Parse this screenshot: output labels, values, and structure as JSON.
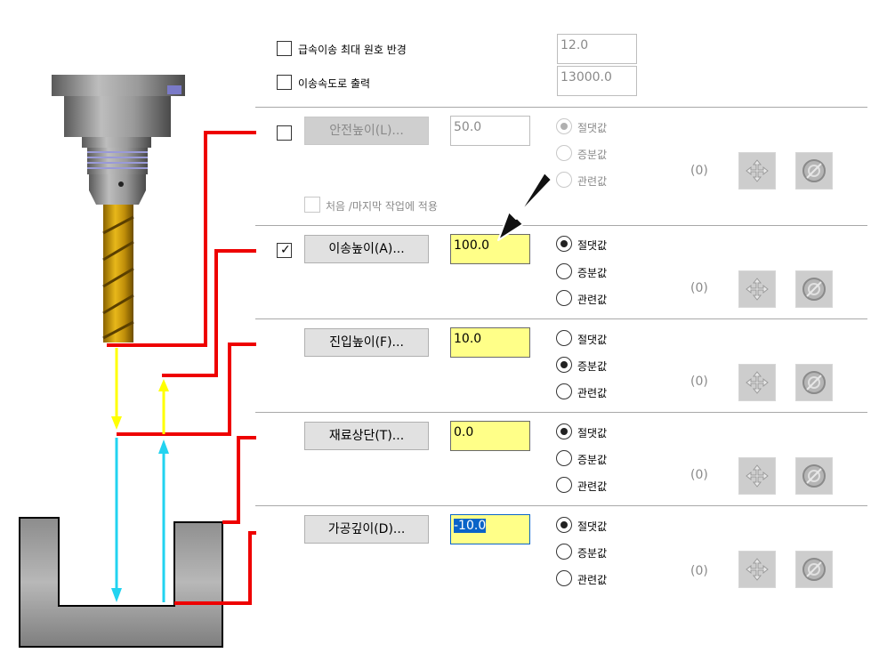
{
  "top": {
    "rapid_arc": {
      "label": "급속이송 최대 원호 반경",
      "value": "12.0"
    },
    "feed_output": {
      "label": "이송속도로 출력",
      "value": "13000.0"
    }
  },
  "options": {
    "absolute": "절댓값",
    "incremental": "증분값",
    "relative": "관련값"
  },
  "apply_first_last": "처음 /마지막 작업에 적용",
  "rows": [
    {
      "button": "안전높이(L)...",
      "value": "50.0",
      "checkbox_checked": false,
      "mode": "absolute",
      "zero": "(0)"
    },
    {
      "button": "이송높이(A)...",
      "value": "100.0",
      "checkbox_checked": true,
      "mode": "absolute",
      "zero": "(0)"
    },
    {
      "button": "진입높이(F)...",
      "value": "10.0",
      "mode": "incremental",
      "zero": "(0)"
    },
    {
      "button": "재료상단(T)...",
      "value": "0.0",
      "mode": "absolute",
      "zero": "(0)"
    },
    {
      "button": "가공깊이(D)...",
      "value": "-10.0",
      "mode": "absolute",
      "zero": "(0)"
    }
  ],
  "colors": {
    "highlight": "#ffff88",
    "selection": "#0a64c8",
    "leader": "#ee0000",
    "arrow_yellow": "#ffff00",
    "arrow_cyan": "#22d3f0"
  },
  "icons": {
    "move": "four-way-arrow-icon",
    "reset": "circle-slash-icon",
    "pointer": "black-arrow-pointer-icon"
  }
}
